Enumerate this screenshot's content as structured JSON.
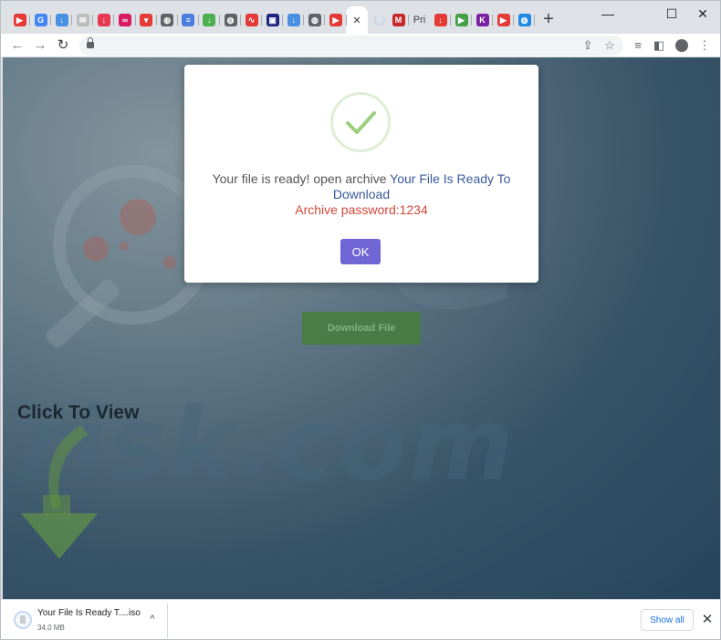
{
  "tabs": [
    {
      "name": "tab-youtube",
      "glyph": "▶",
      "color": "#e53935"
    },
    {
      "name": "tab-google",
      "glyph": "G",
      "color": "#4285f4"
    },
    {
      "name": "tab-cloud-download",
      "glyph": "↓",
      "color": "#4a90e2"
    },
    {
      "name": "tab-mail",
      "glyph": "✉",
      "color": "#bdbdbd"
    },
    {
      "name": "tab-download-red",
      "glyph": "↓",
      "color": "#e53950"
    },
    {
      "name": "tab-link",
      "glyph": "∞",
      "color": "#d81b60"
    },
    {
      "name": "tab-pocket",
      "glyph": "▾",
      "color": "#e53935"
    },
    {
      "name": "tab-globe",
      "glyph": "◍",
      "color": "#5f6368"
    },
    {
      "name": "tab-doc",
      "glyph": "≡",
      "color": "#4a7de0"
    },
    {
      "name": "tab-download-green",
      "glyph": "↓",
      "color": "#4caf50"
    },
    {
      "name": "tab-globe-2",
      "glyph": "◍",
      "color": "#5f6368"
    },
    {
      "name": "tab-wave",
      "glyph": "∿",
      "color": "#e53935"
    },
    {
      "name": "tab-tv",
      "glyph": "▣",
      "color": "#1a237e"
    },
    {
      "name": "tab-cloud",
      "glyph": "↓",
      "color": "#4a90e2"
    },
    {
      "name": "tab-globe-3",
      "glyph": "◍",
      "color": "#5f6368"
    },
    {
      "name": "tab-video",
      "glyph": "▶",
      "color": "#e53935"
    }
  ],
  "tabs_after_active": [
    {
      "name": "tab-mcafee",
      "glyph": "M",
      "color": "#c62828"
    },
    {
      "name": "tab-download-red-2",
      "glyph": "↓",
      "color": "#e53935"
    },
    {
      "name": "tab-play",
      "glyph": "▶",
      "color": "#43a047"
    },
    {
      "name": "tab-kv",
      "glyph": "K",
      "color": "#7b1fa2"
    },
    {
      "name": "tab-youtube-2",
      "glyph": "▶",
      "color": "#e53935"
    },
    {
      "name": "tab-globe-blue",
      "glyph": "◍",
      "color": "#1e88e5"
    }
  ],
  "browser": {
    "pri_tab_label": "Pri",
    "close_tab": "✕",
    "new_tab": "+",
    "minimize": "—",
    "maximize": "☐",
    "close": "✕"
  },
  "modal": {
    "message_prefix": "Your file is ready! open archive ",
    "message_link": "Your File Is Ready To Download",
    "password_line": "Archive password:1234",
    "ok_label": "OK"
  },
  "page": {
    "download_button": "Download File",
    "click_to_view": "Click To View",
    "watermark": "risk.com",
    "watermark_pc": "PC"
  },
  "download_bar": {
    "file_name": "Your File Is Ready T....iso",
    "file_size": "34.0 MB",
    "show_all": "Show all"
  }
}
